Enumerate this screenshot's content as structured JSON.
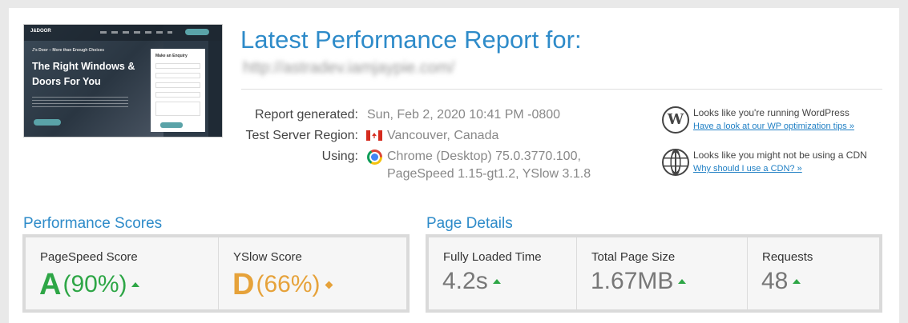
{
  "header": {
    "title": "Latest Performance Report for:",
    "url": "http://astradev.iamjaypie.com/"
  },
  "thumbnail": {
    "logo": "J&DOOR",
    "tagline": "J's Door – More than Enough Choices",
    "headline": "The Right Windows & Doors For You",
    "form_title": "Make an Enquiry"
  },
  "report": {
    "generated_label": "Report generated:",
    "generated_value": "Sun, Feb 2, 2020 10:41 PM -0800",
    "region_label": "Test Server Region:",
    "region_value": "Vancouver, Canada",
    "using_label": "Using:",
    "using_value_line1": "Chrome (Desktop) 75.0.3770.100,",
    "using_value_line2": "PageSpeed 1.15-gt1.2, YSlow 3.1.8"
  },
  "tips": [
    {
      "icon": "wordpress-icon",
      "text": "Looks like you're running WordPress",
      "link": "Have a look at our WP optimization tips »"
    },
    {
      "icon": "globe-icon",
      "text": "Looks like you might not be using a CDN",
      "link": "Why should I use a CDN? »"
    }
  ],
  "performance": {
    "section_title": "Performance Scores",
    "pagespeed": {
      "label": "PageSpeed Score",
      "grade": "A",
      "percent": "(90%)",
      "color": "#2ea646",
      "trend": "up"
    },
    "yslow": {
      "label": "YSlow Score",
      "grade": "D",
      "percent": "(66%)",
      "color": "#e6a23a",
      "trend": "neutral"
    }
  },
  "details": {
    "section_title": "Page Details",
    "fully_loaded": {
      "label": "Fully Loaded Time",
      "value": "4.2s",
      "trend": "up"
    },
    "page_size": {
      "label": "Total Page Size",
      "value": "1.67MB",
      "trend": "up"
    },
    "requests": {
      "label": "Requests",
      "value": "48",
      "trend": "up"
    }
  },
  "colors": {
    "accent": "#2e8bc9",
    "good": "#2ea646",
    "warn": "#e6a23a",
    "link": "#1f7fc4"
  }
}
